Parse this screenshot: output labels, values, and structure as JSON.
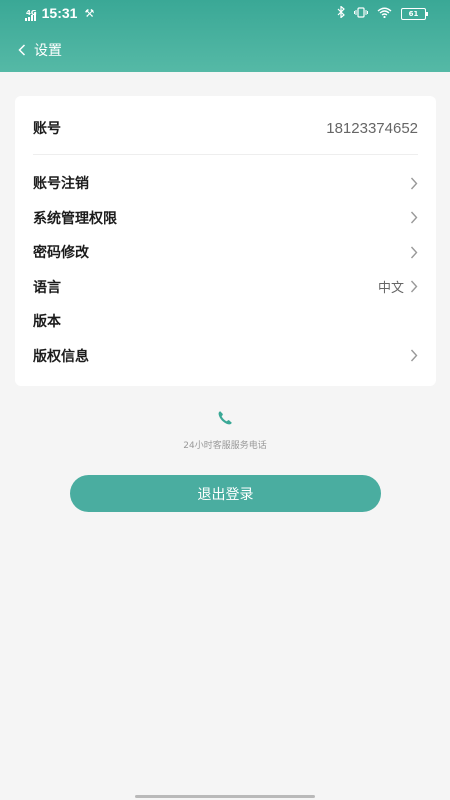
{
  "status_bar": {
    "network": "4G",
    "time": "15:31",
    "battery": "61"
  },
  "nav": {
    "title": "设置"
  },
  "account": {
    "label": "账号",
    "value": "18123374652"
  },
  "menu": [
    {
      "label": "账号注销",
      "value": "",
      "chevron": true
    },
    {
      "label": "系统管理权限",
      "value": "",
      "chevron": true
    },
    {
      "label": "密码修改",
      "value": "",
      "chevron": true
    },
    {
      "label": "语言",
      "value": "中文",
      "chevron": true
    },
    {
      "label": "版本",
      "value": "",
      "chevron": false
    },
    {
      "label": "版权信息",
      "value": "",
      "chevron": true
    }
  ],
  "support": {
    "text": "24小时客服服务电话"
  },
  "logout": {
    "label": "退出登录"
  },
  "colors": {
    "accent": "#4aada0",
    "header": "#3aa896",
    "background": "#f5f5f5"
  },
  "icons": {
    "back": "chevron-left-icon",
    "chevron": "chevron-right-icon",
    "phone": "phone-icon"
  }
}
